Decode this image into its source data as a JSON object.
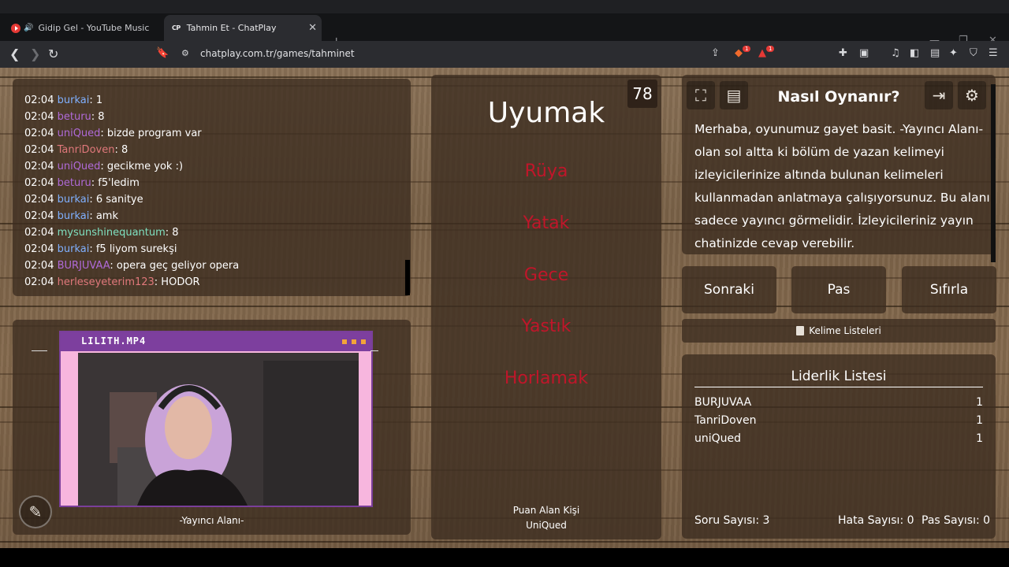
{
  "browser": {
    "tabs": [
      {
        "title": "Gidip Gel - YouTube Music"
      },
      {
        "favicon_text": "CP",
        "title": "Tahmin Et - ChatPlay"
      }
    ],
    "url": "chatplay.com.tr/games/tahminet",
    "brave_badge": "1",
    "alert_badge": "1"
  },
  "chat": {
    "lines": [
      {
        "time": "02:04",
        "user": "burkai",
        "color": "#7fb0ff",
        "msg": ": 1"
      },
      {
        "time": "02:04",
        "user": "beturu",
        "color": "#b06ad8",
        "msg": ": 8"
      },
      {
        "time": "02:04",
        "user": "uniQued",
        "color": "#b06ad8",
        "msg": ": bizde program var"
      },
      {
        "time": "02:04",
        "user": "TanriDoven",
        "color": "#e0787b",
        "msg": ": 8"
      },
      {
        "time": "02:04",
        "user": "uniQued",
        "color": "#b06ad8",
        "msg": ": gecikme yok :)"
      },
      {
        "time": "02:04",
        "user": "beturu",
        "color": "#b06ad8",
        "msg": ": f5'ledim"
      },
      {
        "time": "02:04",
        "user": "burkai",
        "color": "#7fb0ff",
        "msg": ": 6 sanitye"
      },
      {
        "time": "02:04",
        "user": "burkai",
        "color": "#7fb0ff",
        "msg": ": amk"
      },
      {
        "time": "02:04",
        "user": "mysunshinequantum",
        "color": "#7fe0c0",
        "msg": ": 8"
      },
      {
        "time": "02:04",
        "user": "burkai",
        "color": "#7fb0ff",
        "msg": ": f5 liyom surekşi"
      },
      {
        "time": "02:04",
        "user": "BURJUVAA",
        "color": "#b06ad8",
        "msg": ": opera geç geliyor opera"
      },
      {
        "time": "02:04",
        "user": "herleseyeterim123",
        "color": "#e0787b",
        "msg": ": HODOR"
      }
    ]
  },
  "streamer": {
    "window_title": "LILITH.MP4",
    "label": "-Yayıncı Alanı-"
  },
  "card": {
    "timer": "78",
    "word": "Uyumak",
    "taboo_words": [
      "Rüya",
      "Yatak",
      "Gece",
      "Yastık",
      "Horlamak"
    ],
    "scorer_label": "Puan Alan Kişi",
    "scorer_name": "UniQued"
  },
  "howto": {
    "title": "Nasıl Oynanır?",
    "text": "Merhaba, oyunumuz gayet basit. -Yayıncı Alanı- olan sol altta ki bölüm de yazan kelimeyi izleyicilerinize altında bulunan kelimeleri kullanmadan anlatmaya çalışıyorsunuz. Bu alanı sadece yayıncı görmelidir. İzleyicileriniz yayın chatinizde cevap verebilir."
  },
  "controls": {
    "next": "Sonraki",
    "pass": "Pas",
    "reset": "Sıfırla",
    "word_lists": "Kelime Listeleri"
  },
  "leaderboard": {
    "title": "Liderlik Listesi",
    "rows": [
      {
        "name": "BURJUVAA",
        "score": "1"
      },
      {
        "name": "TanriDoven",
        "score": "1"
      },
      {
        "name": "uniQued",
        "score": "1"
      }
    ],
    "question_count": "Soru Sayısı: 3",
    "error_count": "Hata Sayısı: 0",
    "pass_count": "Pas Sayısı: 0"
  },
  "colors": {
    "taboo": "#c0162a",
    "panel": "rgba(60,45,32,0.78)",
    "window_purple": "#7d3f9e",
    "window_pink": "#f7b6de"
  }
}
